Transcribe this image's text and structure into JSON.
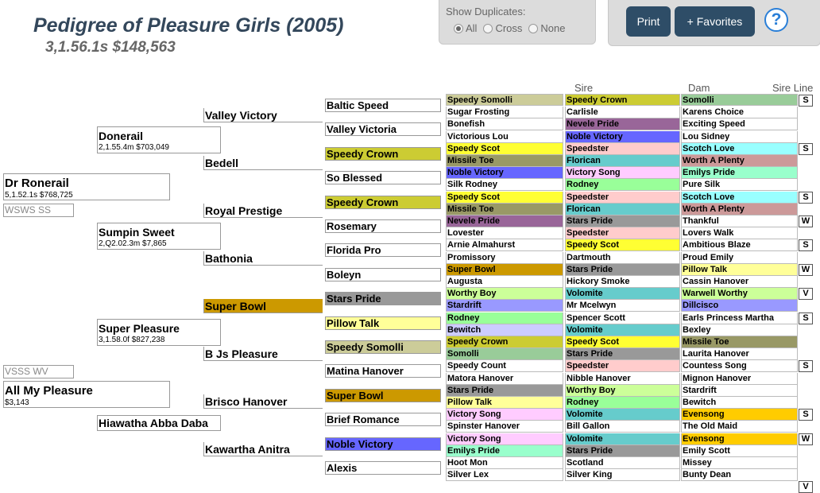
{
  "header": {
    "title": "Pedigree of Pleasure Girls (2005)",
    "subtitle": "3,1.56.1s $148,563"
  },
  "duplicates": {
    "label": "Show Duplicates:",
    "options": [
      "All",
      "Cross",
      "None"
    ],
    "selected": "All"
  },
  "actions": {
    "print": "Print",
    "favorites": "+ Favorites",
    "help": "?"
  },
  "columns": {
    "sire": "Sire",
    "dam": "Dam",
    "sire_line": "Sire Line"
  },
  "pedigree": {
    "sire": {
      "name": "Dr Ronerail",
      "stats": "5,1.52.1s $768,725",
      "code": "WSWS SS"
    },
    "dam": {
      "name": "All My Pleasure",
      "stats": "$3,143",
      "code": "VSSS WV"
    },
    "gen2": [
      {
        "name": "Donerail",
        "stats": "2,1.55.4m $703,049"
      },
      {
        "name": "Sumpin Sweet",
        "stats": "2,Q2.02.3m $7,865"
      },
      {
        "name": "Super Pleasure",
        "stats": "3,1.58.0f $827,238"
      },
      {
        "name": "Hiawatha Abba Daba",
        "stats": ""
      }
    ],
    "gen3": [
      "Valley Victory",
      "Bedell",
      "Royal Prestige",
      "Bathonia",
      "Super Bowl",
      "B Js Pleasure",
      "Brisco Hanover",
      "Kawartha Anitra"
    ],
    "gen4": [
      "Baltic Speed",
      "Valley Victoria",
      "Speedy Crown",
      "So Blessed",
      "Speedy Crown",
      "Rosemary",
      "Florida Pro",
      "Boleyn",
      "Stars Pride",
      "Pillow Talk",
      "Speedy Somolli",
      "Matina Hanover",
      "Super Bowl",
      "Brief Romance",
      "Noble Victory",
      "Alexis"
    ]
  },
  "grid": {
    "col1": [
      "Speedy Somolli",
      "Sugar Frosting",
      "Bonefish",
      "Victorious Lou",
      "Speedy Scot",
      "Missile Toe",
      "Noble Victory",
      "Silk Rodney",
      "Speedy Scot",
      "Missile Toe",
      "Nevele Pride",
      "Lovester",
      "Arnie Almahurst",
      "Promissory",
      "Super Bowl",
      "Augusta",
      "Worthy Boy",
      "Stardrift",
      "Rodney",
      "Bewitch",
      "Speedy Crown",
      "Somolli",
      "Speedy Count",
      "Matora Hanover",
      "Stars Pride",
      "Pillow Talk",
      "Victory Song",
      "Spinster Hanover",
      "Victory Song",
      "Emilys Pride",
      "Hoot Mon",
      "Silver Lex"
    ],
    "col2": [
      "Speedy Crown",
      "Carlisle",
      "Nevele Pride",
      "Noble Victory",
      "Speedster",
      "Florican",
      "Victory Song",
      "Rodney",
      "Speedster",
      "Florican",
      "Stars Pride",
      "Speedster",
      "Speedy Scot",
      "Dartmouth",
      "Stars Pride",
      "Hickory Smoke",
      "Volomite",
      "Mr Mcelwyn",
      "Spencer Scott",
      "Volomite",
      "Speedy Scot",
      "Stars Pride",
      "Speedster",
      "Nibble Hanover",
      "Worthy Boy",
      "Rodney",
      "Volomite",
      "Bill Gallon",
      "Volomite",
      "Stars Pride",
      "Scotland",
      "Silver King"
    ],
    "col3": [
      "Somolli",
      "Karens Choice",
      "Exciting Speed",
      "Lou Sidney",
      "Scotch Love",
      "Worth A Plenty",
      "Emilys Pride",
      "Pure Silk",
      "Scotch Love",
      "Worth A Plenty",
      "Thankful",
      "Lovers Walk",
      "Ambitious Blaze",
      "Proud Emily",
      "Pillow Talk",
      "Cassin Hanover",
      "Warwell Worthy",
      "Dillcisco",
      "Earls Princess Martha",
      "Bexley",
      "Missile Toe",
      "Laurita Hanover",
      "Countess Song",
      "Mignon Hanover",
      "Stardrift",
      "Bewitch",
      "Evensong",
      "The Old Maid",
      "Evensong",
      "Emily Scott",
      "Missey",
      "Bunty Dean"
    ],
    "sire_line": [
      "S",
      "",
      "S",
      "",
      "S",
      "W",
      "S",
      "W",
      "V",
      "S",
      "",
      "S",
      "",
      "S",
      "W",
      "",
      "V"
    ]
  },
  "colors": {
    "speedy_somolli": "#cccc99",
    "speedy_crown": "#cccc33",
    "nevele_pride": "#996699",
    "noble_victory": "#6666ff",
    "speedy_scot": "#ffff33",
    "missile_toe": "#999966",
    "speedster": "#ffcccc",
    "florican": "#66cccc",
    "victory_song": "#ffccff",
    "rodney": "#99ff99",
    "stars_pride": "#999999",
    "super_bowl": "#cc9900",
    "pillow_talk": "#ffff99",
    "worthy_boy": "#ccff99",
    "stardrift": "#9999ff",
    "bewitch": "#ccccff",
    "volomite": "#66cccc",
    "somolli": "#99cc99",
    "emilys_pride": "#99ffcc",
    "scotch_love": "#99ffff",
    "worth_a_plenty": "#cc9999",
    "evensong": "#ffcc00"
  }
}
